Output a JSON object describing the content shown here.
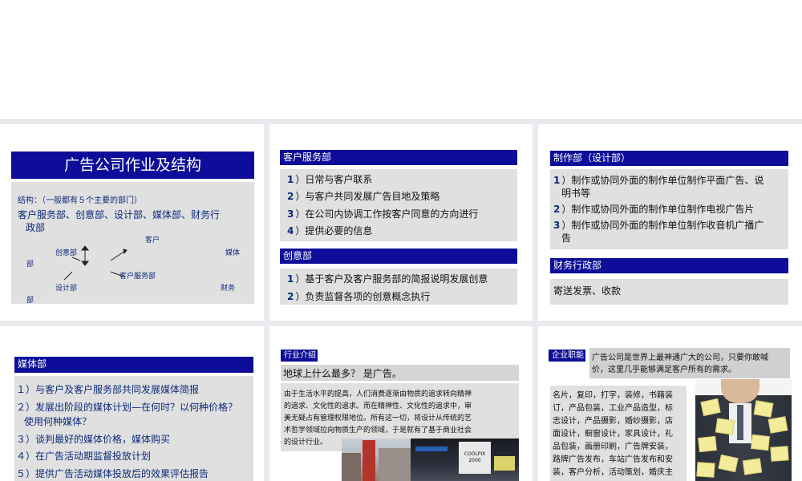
{
  "slide1": {
    "title": "广告公司作业及结构",
    "structure_label": "结构：（一般都有５个主要的部门）",
    "departments_line1": "客户服务部、创意部、设计部、媒体部、财务行",
    "departments_line2": "政部",
    "diagram": {
      "kehu": "客户",
      "meiti": "媒体",
      "bu1": "部",
      "chuangyi": "创意部",
      "kehufuwu": "客户服务部",
      "sheji": "设计部",
      "caiwu": "财务",
      "bu2": "部"
    }
  },
  "slide2": {
    "header1": "客户服务部",
    "items1": [
      {
        "num": "1",
        "text": "）日常与客户联系"
      },
      {
        "num": "2",
        "text": "）与客户共同发展广告目地及策略"
      },
      {
        "num": "3",
        "text": "）在公司内协调工作按客户同意的方向进行"
      },
      {
        "num": "4",
        "text": "）提供必要的信息"
      }
    ],
    "header2": "创意部",
    "items2": [
      {
        "num": "1",
        "text": "）基于客户及客户服务部的简报说明发展创意"
      },
      {
        "num": "2",
        "text": "）负责监督各项的创意概念执行"
      }
    ]
  },
  "slide3": {
    "header1": "制作部（设计部）",
    "item1_line1": "）制作或协同外面的制作单位制作平面广告、说",
    "item1_line2": "明书等",
    "item2": "）制作或协同外面的制作单位制作电视广告片",
    "item3_line1": "）制作或协同外面的制作单位制作收音机广播广",
    "item3_line2": "告",
    "nums": [
      "1",
      "2",
      "3"
    ],
    "header2": "财务行政部",
    "finance_text": "寄送发票、收款"
  },
  "slide4": {
    "header": "媒体部",
    "item1": "１）与客户及客户服务部共同发展媒体简报",
    "item2_line1": "２）发展出阶段的媒体计划—在何时？以何种价格？",
    "item2_line2": "使用何种媒体？",
    "item3": "３）谈判最好的媒体价格，媒体购买",
    "item4": "４）在广告活动期监督投放计划",
    "item5": "５）提供广告活动媒体投放后的效果评估报告"
  },
  "slide5": {
    "tag": "行业介绍",
    "headline": "地球上什么最多？ 是广告。",
    "body": [
      "由于生活水平的提高，人们消费逐渐由物质的追求转向精神",
      "的追求、文化性的追求。而在精神性、文化性的追求中，审",
      "美无疑占有管理权限地位。所有这一切，将设计从传统的艺",
      "术哲学领域拉向物质生产的领域，于是就有了基于商业社会",
      "的设计行业。"
    ],
    "sign_text": "COOLPIX 2000"
  },
  "slide6": {
    "tag": "企业职能",
    "quote_line1": "广告公司是世界上最神通广大的公司，只要你敢喊",
    "quote_line2": "价，这里几乎能够满足客户所有的需求。",
    "services": [
      "名片，复印，打字，装修，书籍装",
      "订，产品包装，工业产品造型，标",
      "志设计，产品摄影，婚纱摄影，店",
      "面设计，橱窗设计，家具设计，礼",
      "品包装，画册印刷，广告牌安装，",
      "路牌广告发布，车站广告发布和安",
      "装，客户分析，活动策划，婚庆主",
      "持，明星造势......"
    ]
  },
  "colors": {
    "header_blue": "#0d0d99",
    "number_blue": "#0d2a7a",
    "panel_grey": "#e0e0e0",
    "background": "#e9ebee"
  }
}
